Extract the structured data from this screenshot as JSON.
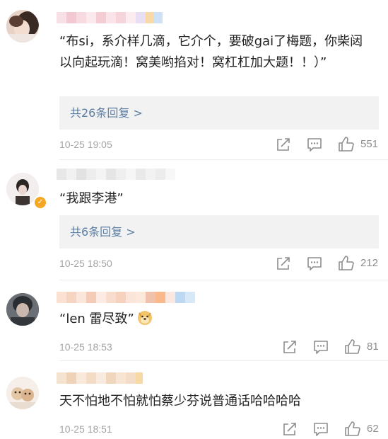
{
  "comments": [
    {
      "text": "“布si，系介样几滴，它介个，要破gai了梅题，你柴闼以向起玩滴！窝美哟掐对！窝杠杠加大题！！）”",
      "replies_label": "共26条回复 >",
      "timestamp": "10-25 19:05",
      "likes": "551",
      "icons": {
        "repost": "repost-icon",
        "comment": "comment-icon",
        "like": "thumbs-up-icon"
      }
    },
    {
      "text": "“我跟李港”",
      "replies_label": "共6条回复 >",
      "timestamp": "10-25 18:50",
      "likes": "212",
      "verified_badge": "verified-badge-icon",
      "icons": {
        "repost": "repost-icon",
        "comment": "comment-icon",
        "like": "thumbs-up-icon"
      }
    },
    {
      "text": "“len 雷尽致”",
      "emoji": "doge-emoji-icon",
      "timestamp": "10-25 18:53",
      "likes": "81",
      "icons": {
        "repost": "repost-icon",
        "comment": "comment-icon",
        "like": "thumbs-up-icon"
      }
    },
    {
      "text": "天不怕地不怕就怕蔡少芬说普通话哈哈哈哈",
      "timestamp": "10-25 18:51",
      "likes": "62",
      "icons": {
        "repost": "repost-icon",
        "comment": "comment-icon",
        "like": "thumbs-up-icon"
      }
    }
  ],
  "colors": {
    "link": "#5b7ea5",
    "meta": "#a3a3a3",
    "reply_bg": "#f2f2f2",
    "verified": "#f5a623"
  }
}
